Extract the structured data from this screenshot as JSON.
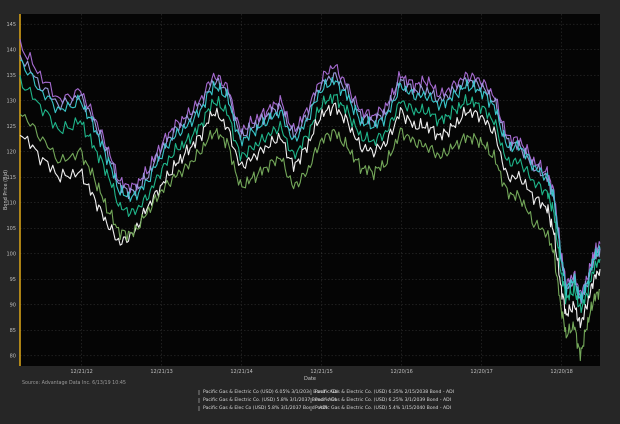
{
  "source_note": "Source: Advantage Data Inc. 6/13/19 10:45",
  "colors": {
    "background": "#262626",
    "plot_background": "#050505",
    "grid": "#3a3a3a",
    "axis_left_accent": "#d4a017"
  },
  "chart_data": {
    "type": "line",
    "title": "",
    "xlabel": "Date",
    "ylabel": "Bond Price (Bid)",
    "ylim": [
      78,
      147
    ],
    "xlim": [
      "2012-03-15",
      "2019-06-13"
    ],
    "grid": true,
    "legend_position": "bottom-center",
    "y_ticks": [
      80,
      85,
      90,
      95,
      100,
      105,
      110,
      115,
      120,
      125,
      130,
      135,
      140,
      145
    ],
    "x_ticks": [
      "12/21/12",
      "12/21/13",
      "12/21/14",
      "12/21/15",
      "12/20/16",
      "12/20/17",
      "12/20/18"
    ],
    "x_tick_dates": [
      "2012-12-21",
      "2013-12-21",
      "2014-12-21",
      "2015-12-21",
      "2016-12-20",
      "2017-12-20",
      "2018-12-20"
    ],
    "x": [
      "2012-03-15",
      "2012-06-15",
      "2012-09-15",
      "2012-12-15",
      "2013-02-15",
      "2013-04-15",
      "2013-06-15",
      "2013-08-15",
      "2013-10-15",
      "2013-12-15",
      "2014-02-15",
      "2014-04-15",
      "2014-06-15",
      "2014-08-15",
      "2014-10-15",
      "2014-12-15",
      "2015-02-15",
      "2015-04-15",
      "2015-06-15",
      "2015-08-15",
      "2015-10-15",
      "2015-12-15",
      "2016-02-15",
      "2016-04-15",
      "2016-06-15",
      "2016-08-15",
      "2016-10-15",
      "2016-12-15",
      "2017-02-15",
      "2017-04-15",
      "2017-06-15",
      "2017-08-15",
      "2017-10-15",
      "2017-12-15",
      "2018-02-15",
      "2018-04-15",
      "2018-06-15",
      "2018-08-15",
      "2018-10-15",
      "2018-11-15",
      "2018-12-15",
      "2019-01-10",
      "2019-02-15",
      "2019-03-15",
      "2019-04-15",
      "2019-05-15",
      "2019-06-13"
    ],
    "series": [
      {
        "name": "Pacific Gas & Electric Co (USD) 6.05% 3/1/2034 Bond - ADI",
        "color": "#39c6c9",
        "values": [
          138,
          132,
          128,
          130,
          125,
          119,
          112,
          111,
          114,
          119,
          123,
          125,
          128,
          133,
          131,
          122,
          124,
          126,
          128,
          122,
          126,
          132,
          134,
          131,
          126,
          125,
          127,
          133,
          131,
          131,
          129,
          131,
          133,
          132,
          129,
          121,
          121,
          117,
          115,
          111,
          100,
          93,
          95,
          91,
          94,
          99,
          101
        ]
      },
      {
        "name": "Pacific Gas & Electric Co. (USD) 6.35% 2/15/2038 Bond - ADI",
        "color": "#a66bd1",
        "values": [
          141,
          135,
          130,
          132,
          127,
          121,
          114,
          113,
          116,
          121,
          125,
          127,
          130,
          135,
          133,
          124,
          126,
          128,
          130,
          124,
          128,
          134,
          137,
          133,
          128,
          127,
          129,
          135,
          133,
          134,
          131,
          133,
          135,
          134,
          131,
          123,
          122,
          118,
          116,
          112,
          101,
          94,
          96,
          92,
          95,
          100,
          102
        ]
      },
      {
        "name": "Pacific Gas & Electric Co. (USD) 5.8% 3/1/2037 Bond - ADI",
        "color": "#1fb58a",
        "values": [
          134,
          129,
          124,
          126,
          121,
          116,
          109,
          108,
          111,
          116,
          120,
          122,
          125,
          130,
          128,
          119,
          121,
          123,
          125,
          119,
          123,
          129,
          131,
          128,
          123,
          122,
          124,
          130,
          128,
          128,
          126,
          128,
          130,
          129,
          126,
          118,
          118,
          114,
          112,
          108,
          97,
          91,
          93,
          89,
          92,
          97,
          99
        ]
      },
      {
        "name": "Pacific Gas & Electric Co. (USD) 6.25% 3/1/2039 Bond - ADI",
        "color": "#9a9adb",
        "values": [
          139,
          133,
          129,
          131,
          126,
          120,
          113,
          112,
          115,
          120,
          124,
          126,
          129,
          134,
          132,
          123,
          125,
          127,
          129,
          123,
          127,
          133,
          135,
          132,
          127,
          126,
          128,
          134,
          132,
          132,
          130,
          132,
          134,
          133,
          130,
          122,
          121,
          117,
          115,
          111,
          100,
          93,
          95,
          91,
          94,
          99,
          101
        ]
      },
      {
        "name": "Pacific Gas & Elec Co (USD) 5.8% 3/1/2037 Bond - ADI",
        "color": "#f0f0f0",
        "values": [
          124,
          119,
          115,
          116,
          111,
          106,
          102,
          104,
          109,
          113,
          117,
          120,
          123,
          128,
          125,
          117,
          119,
          121,
          123,
          117,
          121,
          127,
          129,
          126,
          121,
          120,
          122,
          128,
          125,
          125,
          123,
          125,
          128,
          127,
          124,
          115,
          115,
          111,
          109,
          104,
          94,
          88,
          90,
          86,
          90,
          95,
          97
        ]
      },
      {
        "name": "Pacific Gas & Electric Co. (USD) 5.4% 1/15/2040 Bond - ADI",
        "color": "#74a85a",
        "values": [
          128,
          123,
          118,
          120,
          115,
          109,
          104,
          104,
          108,
          112,
          115,
          117,
          120,
          124,
          122,
          113,
          115,
          117,
          119,
          113,
          116,
          122,
          124,
          121,
          117,
          116,
          118,
          124,
          122,
          121,
          119,
          121,
          123,
          122,
          119,
          112,
          111,
          106,
          104,
          100,
          90,
          84,
          86,
          80,
          86,
          91,
          93
        ]
      }
    ]
  }
}
